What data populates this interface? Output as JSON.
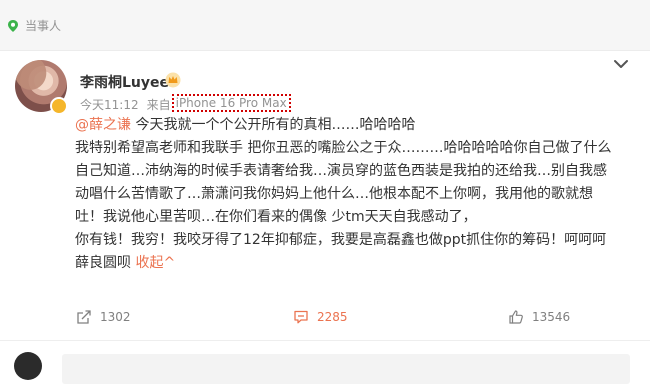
{
  "tag": {
    "label": "当事人"
  },
  "author": {
    "name": "李雨桐Luyee"
  },
  "meta": {
    "time": "今天11:12",
    "source_prefix": "来自",
    "device": "iPhone 16 Pro Max"
  },
  "post": {
    "lines": [
      {
        "mention": "@薛之谦",
        "text": " 今天我就一个个公开所有的真相……哈哈哈哈"
      },
      {
        "text": "我特别希望高老师和我联手 把你丑恶的嘴脸公之于众………哈哈哈哈哈你自己做了什么"
      },
      {
        "text": "自己知道…沛纳海的时候手表请奢给我…演员穿的蓝色西装是我拍的还给我…别自我感"
      },
      {
        "text": "动唱什么苦情歌了…萧潇问我你妈妈上他什么…他根本配不上你啊，我用他的歌就想"
      },
      {
        "text": "吐！我说他心里苦呗…在你们看来的偶像 少tm天天自我感动了，"
      },
      {
        "text": "你有钱！我穷！我咬牙得了12年抑郁症，我要是高磊鑫也做ppt抓住你的筹码！呵呵呵"
      },
      {
        "text": "薛良圆呗 ",
        "collapse": "收起^"
      }
    ]
  },
  "actions": {
    "repost_count": "1302",
    "comment_count": "2285",
    "like_count": "13546"
  },
  "colors": {
    "accent": "#eb7350",
    "muted": "#939393",
    "highlight_box": "#d00000",
    "tag_icon": "#3bb34a"
  }
}
